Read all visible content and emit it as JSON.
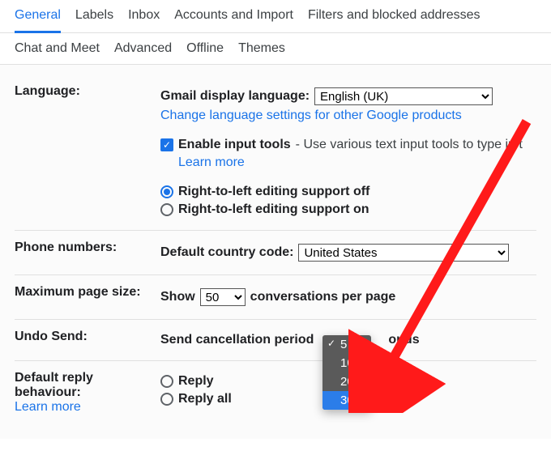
{
  "tabs_row1": [
    "General",
    "Labels",
    "Inbox",
    "Accounts and Import",
    "Filters and blocked addresses"
  ],
  "tabs_row2": [
    "Chat and Meet",
    "Advanced",
    "Offline",
    "Themes"
  ],
  "active_tab": "General",
  "language": {
    "label": "Language:",
    "display_label": "Gmail display language:",
    "display_value": "English (UK)",
    "change_link": "Change language settings for other Google products",
    "enable_tools_label": "Enable input tools",
    "enable_tools_desc": " - Use various text input tools to type in t",
    "learn_more": "Learn more",
    "rtl_off": "Right-to-left editing support off",
    "rtl_on": "Right-to-left editing support on"
  },
  "phone": {
    "label": "Phone numbers:",
    "code_label": "Default country code:",
    "code_value": "United States"
  },
  "pagesize": {
    "label": "Maximum page size:",
    "show": "Show",
    "value": "50",
    "suffix": "conversations per page"
  },
  "undo": {
    "label": "Undo Send:",
    "prefix": "Send cancellation period",
    "suffix": "onds",
    "options": [
      "5",
      "10",
      "20",
      "30"
    ],
    "selected": "5",
    "highlighted": "30"
  },
  "reply": {
    "label1": "Default reply",
    "label2": "behaviour:",
    "learn_more": "Learn more",
    "reply": "Reply",
    "reply_all": "Reply all"
  }
}
